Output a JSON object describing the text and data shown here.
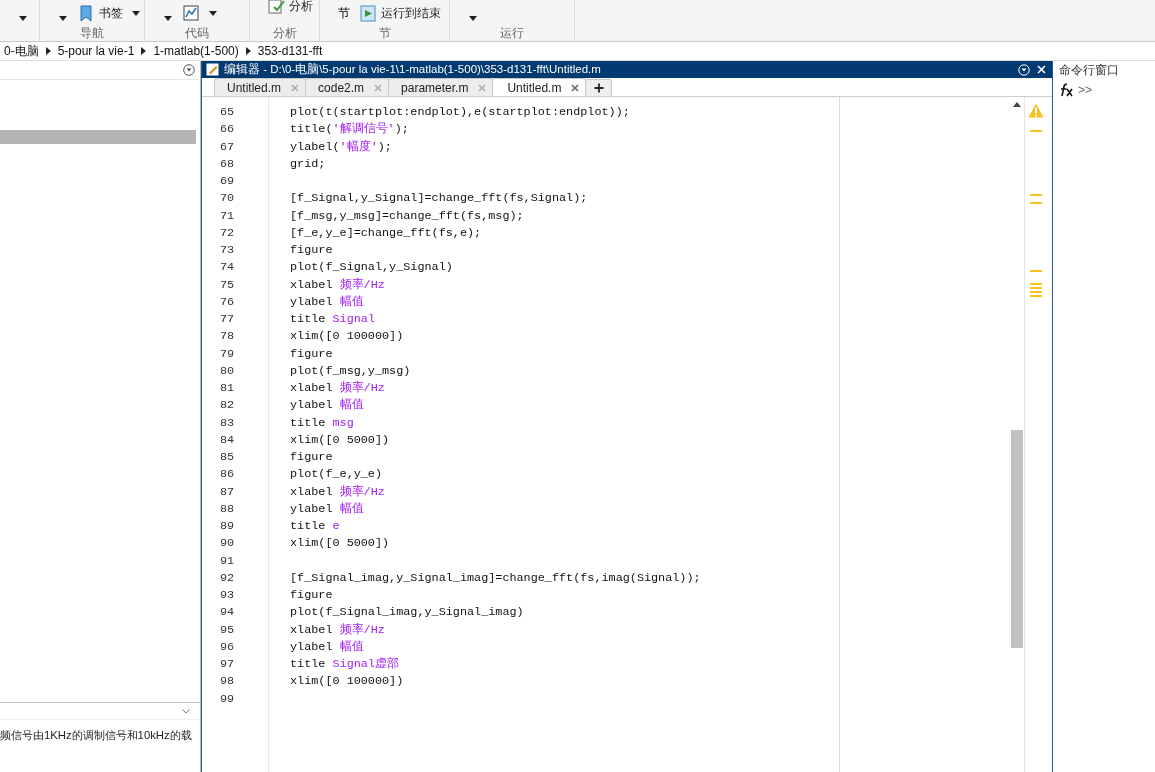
{
  "toolstrip": {
    "groups": [
      {
        "items": [
          {
            "kind": "caret"
          }
        ]
      },
      {
        "label": "导航",
        "items": [
          {
            "kind": "caret"
          },
          {
            "kind": "bookmark",
            "label": "书签"
          }
        ]
      },
      {
        "label": "代码",
        "items": [
          {
            "kind": "caret"
          },
          {
            "kind": "chart"
          }
        ]
      },
      {
        "label": "分析",
        "items": [
          {
            "kind": "analyze",
            "label": "分析"
          }
        ]
      },
      {
        "label": "节",
        "items": [
          {
            "kind": "text",
            "label": "节"
          },
          {
            "kind": "run",
            "label": "运行到结束"
          }
        ]
      },
      {
        "label": "运行",
        "items": [
          {
            "kind": "caret"
          }
        ]
      }
    ]
  },
  "breadcrumb": [
    "0-电脑",
    "5-pour la vie-1",
    "1-matlab(1-500)",
    "353-d131-fft"
  ],
  "file_panel": {
    "description": "频信号由1KHz的调制信号和10kHz的载"
  },
  "editor": {
    "title": "编辑器 - D:\\0-电脑\\5-pour la vie-1\\1-matlab(1-500)\\353-d131-fft\\Untitled.m",
    "tabs": [
      {
        "label": "Untitled.m",
        "selected": false
      },
      {
        "label": "code2.m",
        "selected": false
      },
      {
        "label": "parameter.m",
        "selected": false
      },
      {
        "label": "Untitled.m",
        "selected": true
      }
    ],
    "lines": [
      {
        "number": "65",
        "code": "plot(t(startplot:endplot),e(startplot:endplot));"
      },
      {
        "number": "66",
        "code": "title(",
        "string": "'解调信号'",
        "after": ");"
      },
      {
        "number": "67",
        "code": "ylabel(",
        "string": "'幅度'",
        "after": ");"
      },
      {
        "number": "68",
        "code": "grid;"
      },
      {
        "number": "69"
      },
      {
        "number": "70",
        "code": "[f_Signal,y_Signal]=change_fft(fs,Signal);"
      },
      {
        "number": "71",
        "code": "[f_msg,y_msg]=change_fft(fs,msg);"
      },
      {
        "number": "72",
        "code": "[f_e,y_e]=change_fft(fs,e);"
      },
      {
        "number": "73",
        "code": "figure"
      },
      {
        "number": "74",
        "code": "plot(f_Signal,y_Signal)"
      },
      {
        "number": "75",
        "code": "xlabel ",
        "string": "频率/Hz"
      },
      {
        "number": "76",
        "code": "ylabel ",
        "string": "幅值"
      },
      {
        "number": "77",
        "code": "title ",
        "string": "Signal"
      },
      {
        "number": "78",
        "code": "xlim([0 100000])"
      },
      {
        "number": "79",
        "code": "figure"
      },
      {
        "number": "80",
        "code": "plot(f_msg,y_msg)"
      },
      {
        "number": "81",
        "code": "xlabel ",
        "string": "频率/Hz"
      },
      {
        "number": "82",
        "code": "ylabel ",
        "string": "幅值"
      },
      {
        "number": "83",
        "code": "title ",
        "string": "msg"
      },
      {
        "number": "84",
        "code": "xlim([0 5000])"
      },
      {
        "number": "85",
        "code": "figure"
      },
      {
        "number": "86",
        "code": "plot(f_e,y_e)"
      },
      {
        "number": "87",
        "code": "xlabel ",
        "string": "频率/Hz"
      },
      {
        "number": "88",
        "code": "ylabel ",
        "string": "幅值"
      },
      {
        "number": "89",
        "code": "title ",
        "string": "e"
      },
      {
        "number": "90",
        "code": "xlim([0 5000])"
      },
      {
        "number": "91"
      },
      {
        "number": "92",
        "code": "[f_Signal_imag,y_Signal_imag]=change_fft(fs,imag(Signal));"
      },
      {
        "number": "93",
        "code": "figure"
      },
      {
        "number": "94",
        "code": "plot(f_Signal_imag,y_Signal_imag)"
      },
      {
        "number": "95",
        "code": "xlabel ",
        "string": "频率/Hz"
      },
      {
        "number": "96",
        "code": "ylabel ",
        "string": "幅值"
      },
      {
        "number": "97",
        "code": "title ",
        "string": "Signal虚部"
      },
      {
        "number": "98",
        "code": "xlim([0 100000])"
      },
      {
        "number": "99"
      }
    ]
  },
  "command_window": {
    "title": "命令行窗口",
    "prompt": ">>"
  }
}
